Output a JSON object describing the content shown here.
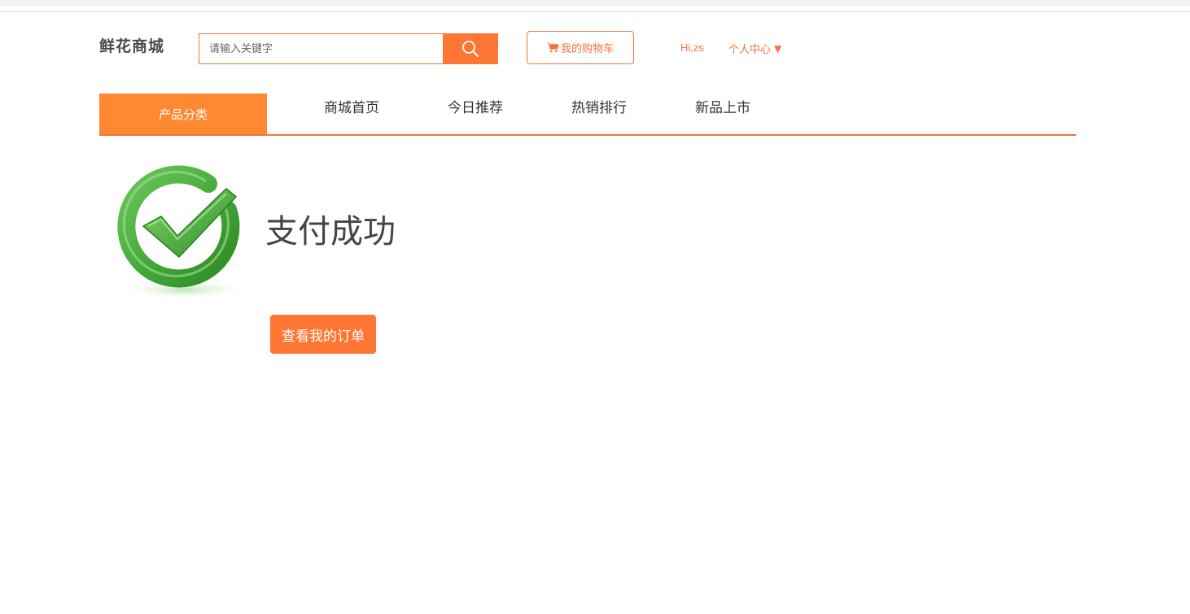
{
  "header": {
    "logo": "鲜花商城",
    "search": {
      "placeholder": "请输入关键字",
      "value": "",
      "button_icon": "search-icon"
    },
    "cart_label": "我的购物车",
    "cart_icon": "cart-icon",
    "greeting": "Hi,zs",
    "user_center_label": "个人中心",
    "user_center_caret": "▼"
  },
  "nav": {
    "category_label": "产品分类",
    "items": [
      {
        "label": "商城首页"
      },
      {
        "label": "今日推荐"
      },
      {
        "label": "热销排行"
      },
      {
        "label": "新品上市"
      }
    ]
  },
  "main": {
    "status_icon": "success-check-icon",
    "title": "支付成功",
    "orders_button_label": "查看我的订单"
  },
  "colors": {
    "accent": "#fd7633",
    "category_bg": "#ff8833",
    "border": "#f0743b",
    "success_green": "#3fa535"
  }
}
